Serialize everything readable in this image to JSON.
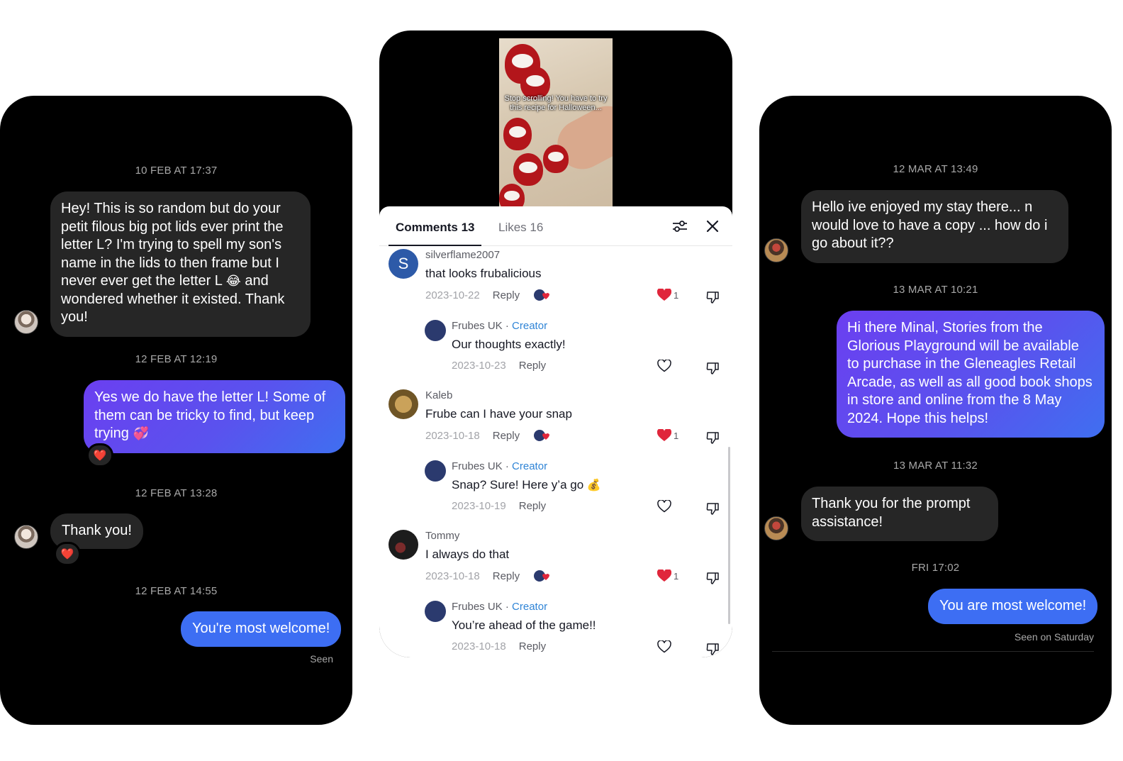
{
  "left_chat": {
    "timestamps": [
      "10 FEB AT 17:37",
      "12 FEB AT 12:19",
      "12 FEB AT 13:28",
      "12 FEB AT 14:55"
    ],
    "messages": [
      {
        "text_a": "Hey! This is so random but do your petit filous big pot lids ever print the letter L? I'm trying to spell my son's name in the lids to then frame but I never ever get the letter L",
        "emoji": "😂",
        "text_b": " and wondered whether it existed. Thank you!"
      },
      {
        "text": "Yes we do have the letter L! Some of them can be tricky to find, but keep trying",
        "emoji": "💞"
      },
      {
        "text": "Thank you!"
      },
      {
        "text": "You're most welcome!"
      }
    ],
    "reaction_emoji": "❤️",
    "seen": "Seen"
  },
  "right_chat": {
    "timestamps": [
      "12 MAR AT 13:49",
      "13 MAR AT 10:21",
      "13 MAR AT 11:32",
      "FRI 17:02"
    ],
    "messages": [
      {
        "text": "Hello ive enjoyed my stay there... n would love to have a copy ... how do i go about it??"
      },
      {
        "text": "Hi there Minal, Stories from the Glorious Playground will be available to purchase in the Gleneagles Retail Arcade, as well as all good book shops in store and online from the 8 May 2024. Hope this helps!"
      },
      {
        "text": "Thank you for the prompt assistance!"
      },
      {
        "text": "You are most welcome!"
      }
    ],
    "seen": "Seen on Saturday"
  },
  "video": {
    "caption": "Stop scrolling! You have to try this recipe for Halloween..."
  },
  "comments_panel": {
    "tabs": [
      {
        "label": "Comments 13",
        "active": true
      },
      {
        "label": "Likes 16",
        "active": false
      }
    ],
    "accent_like": "#e0263b",
    "creator_color": "#2f84d6",
    "comments": [
      {
        "user": "silverflame2007",
        "avatar_letter": "S",
        "text": "that looks frubalicious",
        "date": "2023-10-22",
        "reply": "Reply",
        "likes": "1",
        "liked": true
      },
      {
        "user": "Frubes UK",
        "creator": "Creator",
        "text": "Our thoughts exactly!",
        "date": "2023-10-23",
        "reply": "Reply",
        "liked": false,
        "is_reply": true
      },
      {
        "user": "Kaleb",
        "text": "Frube can I have your snap",
        "date": "2023-10-18",
        "reply": "Reply",
        "likes": "1",
        "liked": true
      },
      {
        "user": "Frubes UK",
        "creator": "Creator",
        "text": "Snap? Sure! Here y’a go",
        "emoji": "💰",
        "date": "2023-10-19",
        "reply": "Reply",
        "liked": false,
        "is_reply": true
      },
      {
        "user": "Tommy",
        "text": "I always do that",
        "date": "2023-10-18",
        "reply": "Reply",
        "likes": "1",
        "liked": true
      },
      {
        "user": "Frubes UK",
        "creator": "Creator",
        "text": "You’re ahead of the game!!",
        "date": "2023-10-18",
        "reply": "Reply",
        "liked": false,
        "is_reply": true
      }
    ],
    "creator_sep": " · "
  }
}
